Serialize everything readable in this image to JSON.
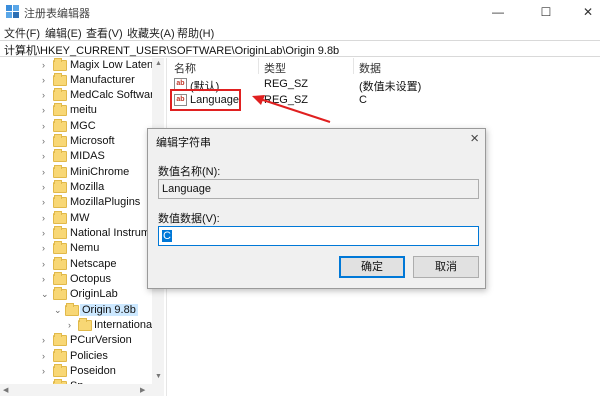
{
  "window": {
    "title": "注册表编辑器",
    "buttons": {
      "minimize": "—",
      "maximize": "☐",
      "close": "✕"
    }
  },
  "menu": [
    "文件(F)",
    "编辑(E)",
    "查看(V)",
    "收藏夹(A)",
    "帮助(H)"
  ],
  "address": "计算机\\HKEY_CURRENT_USER\\SOFTWARE\\OriginLab\\Origin 9.8b",
  "tree": {
    "items": [
      {
        "label": "Magix Low Latency",
        "expanded": false
      },
      {
        "label": "Manufacturer",
        "expanded": false
      },
      {
        "label": "MedCalc Software",
        "expanded": false
      },
      {
        "label": "meitu",
        "expanded": false
      },
      {
        "label": "MGC",
        "expanded": false
      },
      {
        "label": "Microsoft",
        "expanded": false
      },
      {
        "label": "MIDAS",
        "expanded": false
      },
      {
        "label": "MiniChrome",
        "expanded": false
      },
      {
        "label": "Mozilla",
        "expanded": false
      },
      {
        "label": "MozillaPlugins",
        "expanded": false
      },
      {
        "label": "MW",
        "expanded": false
      },
      {
        "label": "National Instrume",
        "expanded": false
      },
      {
        "label": "Nemu",
        "expanded": false
      },
      {
        "label": "Netscape",
        "expanded": false
      },
      {
        "label": "Octopus",
        "expanded": false
      },
      {
        "label": "OriginLab",
        "expanded": true
      },
      {
        "label": "Origin 9.8b",
        "expanded": true,
        "selected": true
      },
      {
        "label": "International",
        "expanded": false
      },
      {
        "label": "PCurVersion",
        "expanded": false
      },
      {
        "label": "Policies",
        "expanded": false
      },
      {
        "label": "Poseidon",
        "expanded": false
      },
      {
        "label": "Sp...",
        "expanded": false
      }
    ]
  },
  "list": {
    "columns": {
      "name": "名称",
      "type": "类型",
      "data": "数据"
    },
    "rows": [
      {
        "name": "(默认)",
        "type": "REG_SZ",
        "data": "(数值未设置)",
        "icon": "string-value-icon"
      },
      {
        "name": "Language",
        "type": "REG_SZ",
        "data": "C",
        "icon": "string-value-icon"
      }
    ]
  },
  "dialog": {
    "title": "编辑字符串",
    "name_label": "数值名称(N):",
    "name_value": "Language",
    "data_label": "数值数据(V):",
    "data_value": "C",
    "ok_label": "确定",
    "cancel_label": "取消"
  },
  "annotation": {
    "highlight_color": "#e02020"
  },
  "colors": {
    "folder": "#f8d775",
    "selection": "#cce8ff",
    "accent": "#0078d7"
  }
}
